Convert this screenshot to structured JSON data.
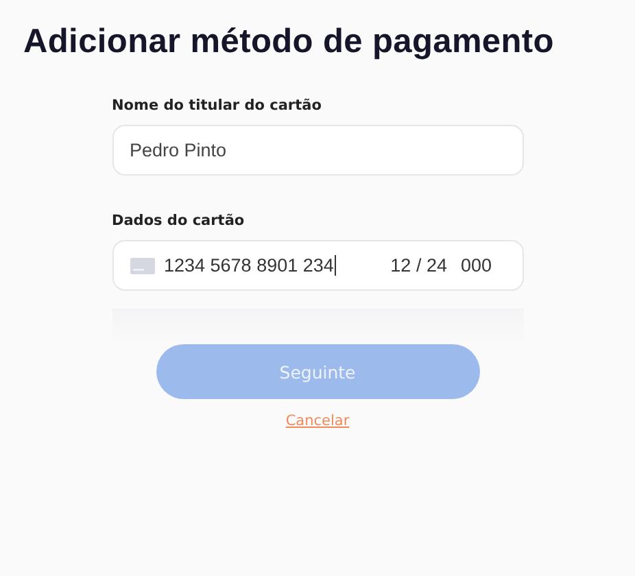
{
  "title": "Adicionar método de pagamento",
  "holder_field": {
    "label": "Nome do titular do cartão",
    "value": "Pedro Pinto"
  },
  "card_field": {
    "label": "Dados do cartão",
    "number": "1234 5678 8901 234",
    "expiry": "12 / 24",
    "cvc": "000"
  },
  "next_button": {
    "label": "Seguinte",
    "disabled": true
  },
  "cancel_link": "Cancelar"
}
